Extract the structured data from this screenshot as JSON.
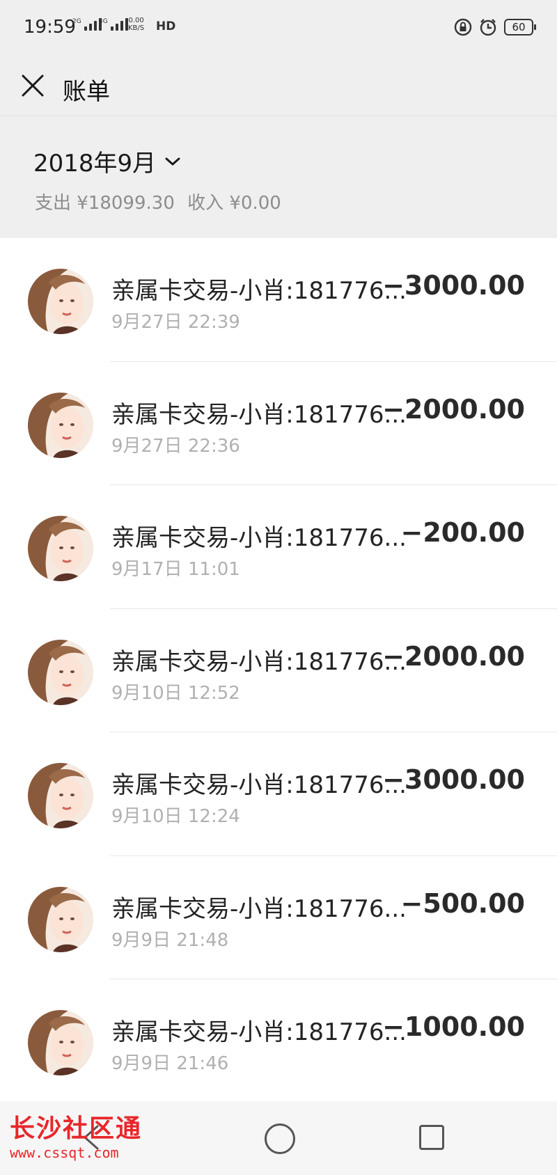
{
  "status_bar": {
    "time": "19:59",
    "signal1_tag": "2G",
    "signal2_tag": "4G",
    "net_speed_value": "0.00",
    "net_speed_unit": "KB/S",
    "hd_label": "HD",
    "battery": "60"
  },
  "header": {
    "close_icon": "close-icon",
    "title": "账单"
  },
  "summary": {
    "month": "2018年9月",
    "expense_label": "支出 ¥18099.30",
    "income_label": "收入 ¥0.00"
  },
  "transactions": [
    {
      "title": "亲属卡交易-小肖:181776...",
      "time": "9月27日 22:39",
      "amount": "−3000.00"
    },
    {
      "title": "亲属卡交易-小肖:181776...",
      "time": "9月27日 22:36",
      "amount": "−2000.00"
    },
    {
      "title": "亲属卡交易-小肖:181776...",
      "time": "9月17日 11:01",
      "amount": "−200.00"
    },
    {
      "title": "亲属卡交易-小肖:181776...",
      "time": "9月10日 12:52",
      "amount": "−2000.00"
    },
    {
      "title": "亲属卡交易-小肖:181776...",
      "time": "9月10日 12:24",
      "amount": "−3000.00"
    },
    {
      "title": "亲属卡交易-小肖:181776...",
      "time": "9月9日 21:48",
      "amount": "−500.00"
    },
    {
      "title": "亲属卡交易-小肖:181776...",
      "time": "9月9日 21:46",
      "amount": "−1000.00"
    }
  ],
  "watermark": {
    "title": "长沙社区通",
    "url": "www.cssqt.com"
  },
  "colors": {
    "header_bg": "#efefef",
    "muted_text": "#8d8d8d",
    "time_text": "#b0b0b0",
    "watermark_red": "#e8262a"
  }
}
